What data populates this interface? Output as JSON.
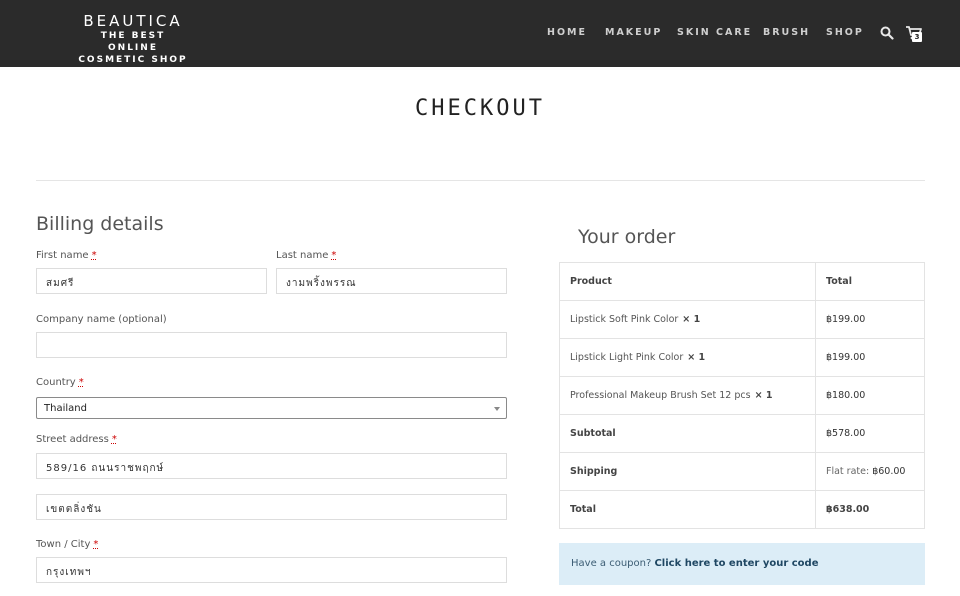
{
  "header": {
    "brand": "BEAUTICA",
    "tagline_1": "THE BEST ONLINE",
    "tagline_2": "COSMETIC SHOP",
    "nav": [
      "HOME",
      "MAKEUP",
      "SKIN CARE",
      "BRUSH",
      "SHOP"
    ],
    "cart_count": "3",
    "icons": [
      "search-icon",
      "cart-icon"
    ],
    "bar_color": "#2b2b2b"
  },
  "page_title": "CHECKOUT",
  "billing": {
    "title": "Billing details",
    "first_name": {
      "label": "First name",
      "required": "*",
      "value": "สมศรี"
    },
    "last_name": {
      "label": "Last name",
      "required": "*",
      "value": "งามพริ้งพรรณ"
    },
    "company": {
      "label": "Company name (optional)",
      "value": ""
    },
    "country": {
      "label": "Country",
      "required": "*",
      "value": "Thailand"
    },
    "street": {
      "label": "Street address",
      "required": "*",
      "value": "589/16 ถนนราชพฤกษ์",
      "value_2": "เขตตลิ่งชัน"
    },
    "city": {
      "label": "Town / City",
      "required": "*",
      "value": "กรุงเทพฯ"
    }
  },
  "order": {
    "title": "Your order",
    "col_product": "Product",
    "col_total": "Total",
    "items": [
      {
        "name": "Lipstick Soft Pink Color",
        "qty": "× 1",
        "total": "฿199.00"
      },
      {
        "name": "Lipstick Light Pink Color",
        "qty": "× 1",
        "total": "฿199.00"
      },
      {
        "name": "Professional Makeup Brush Set 12 pcs",
        "qty": "× 1",
        "total": "฿180.00"
      }
    ],
    "subtotal_label": "Subtotal",
    "subtotal": "฿578.00",
    "shipping_label": "Shipping",
    "shipping_prefix": "Flat rate: ",
    "shipping": "฿60.00",
    "total_label": "Total",
    "total": "฿638.00"
  },
  "coupon": {
    "text": "Have a coupon? ",
    "link": "Click here to enter your code"
  }
}
